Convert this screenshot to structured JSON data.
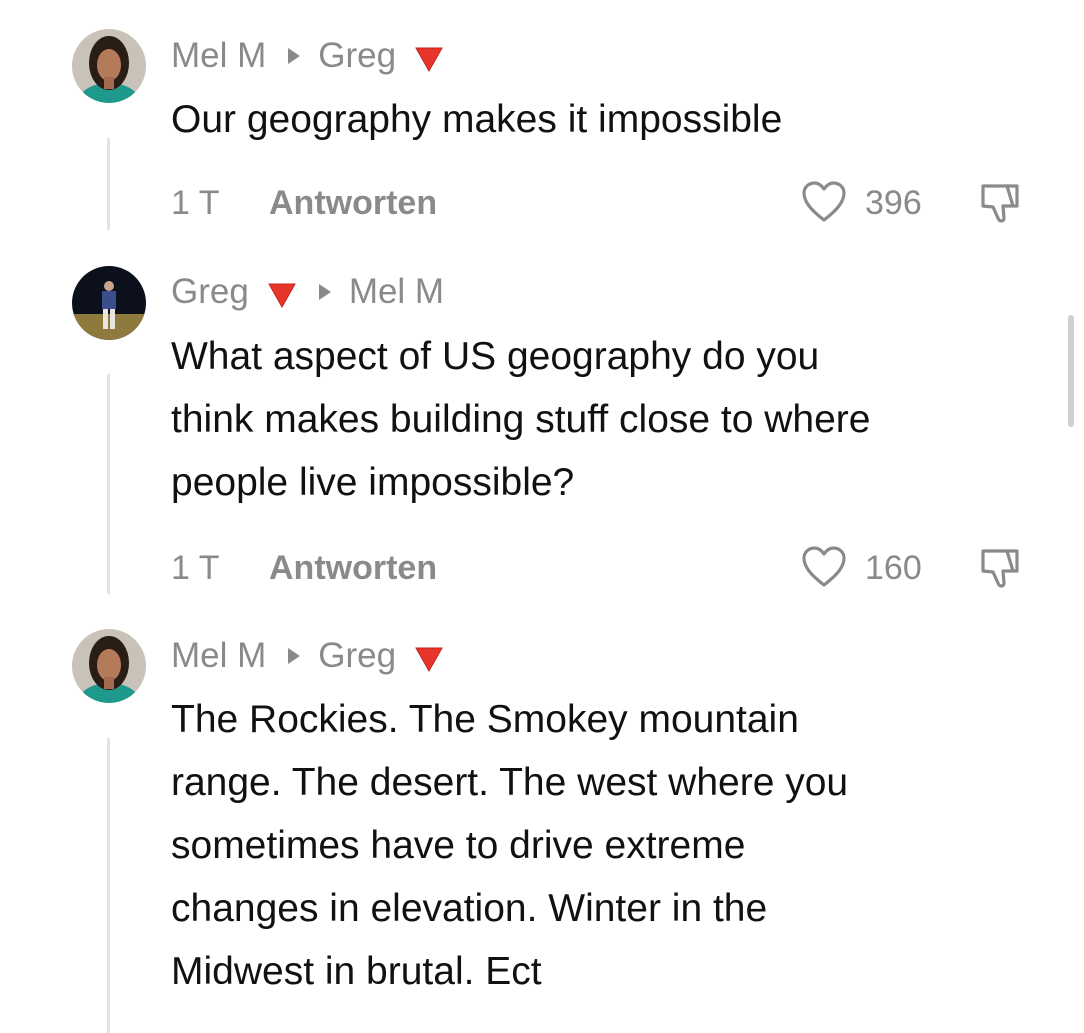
{
  "comments": [
    {
      "author": "Mel M",
      "reply_to": "Greg",
      "text_lines": [
        "Our geography makes it impossible"
      ],
      "time": "1 T",
      "reply_label": "Antworten",
      "likes": "396"
    },
    {
      "author": "Greg",
      "reply_to": "Mel M",
      "text_lines": [
        "What aspect of US geography do you",
        "think makes building stuff close to where",
        "people live impossible?"
      ],
      "time": "1 T",
      "reply_label": "Antworten",
      "likes": "160"
    },
    {
      "author": "Mel M",
      "reply_to": "Greg",
      "text_lines": [
        "The Rockies. The Smokey mountain",
        "range. The desert. The west where you",
        "sometimes have to drive extreme",
        "changes in elevation. Winter in the",
        "Midwest in brutal. Ect"
      ]
    }
  ],
  "icons": {
    "flag": "red-triangle-down-icon",
    "separator": "play-arrow-icon",
    "like": "heart-outline-icon",
    "dislike": "thumbs-down-outline-icon"
  },
  "colors": {
    "text": "#111111",
    "meta": "#8a8a8a",
    "flag_red": "#e8352b",
    "thread_line": "#e3e3e3"
  }
}
